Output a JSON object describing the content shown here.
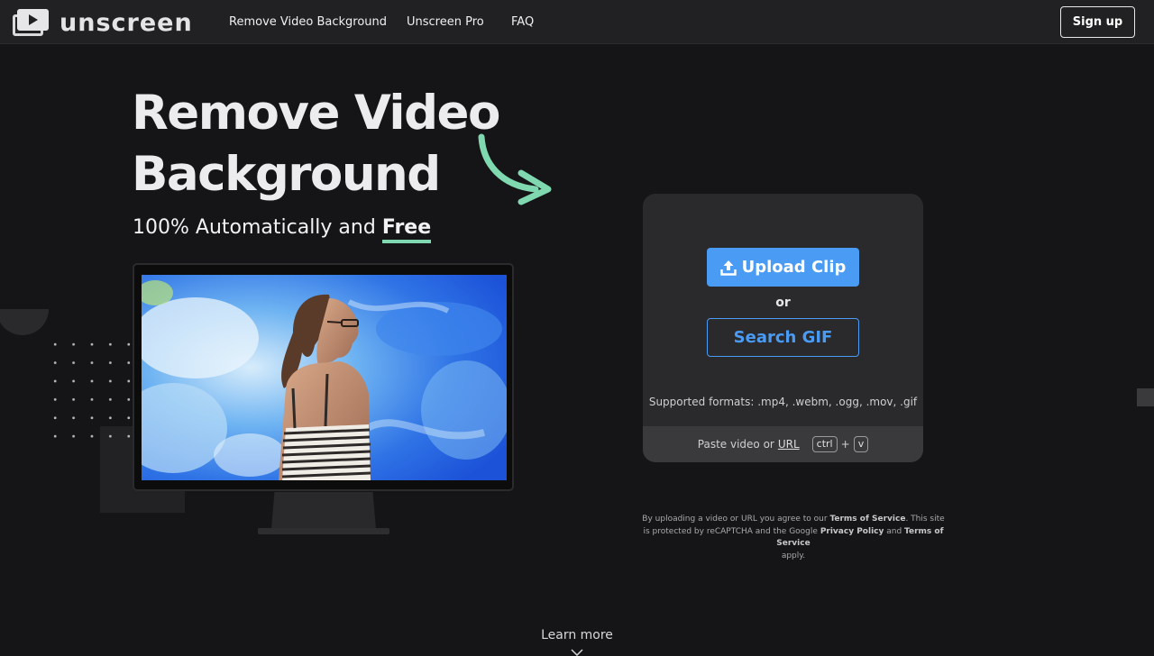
{
  "nav": {
    "brand": "unscreen",
    "links": [
      "Remove Video Background",
      "Unscreen Pro",
      "FAQ"
    ],
    "signup": "Sign up"
  },
  "hero": {
    "title_line1": "Remove Video",
    "title_line2": "Background",
    "subtitle_prefix": "100% Automatically and",
    "subtitle_emph": "Free"
  },
  "card": {
    "upload": "Upload Clip",
    "or": "or",
    "search": "Search GIF",
    "formats": "Supported formats: .mp4, .webm, .ogg, .mov, .gif",
    "paste_prefix": "Paste video or",
    "paste_url": "URL",
    "kbd_ctrl": "ctrl",
    "kbd_plus": "+",
    "kbd_v": "v"
  },
  "legal": {
    "t1": "By uploading a video or URL you agree to our",
    "tos1": "Terms of Service",
    "t2": ". This site is protected by reCAPTCHA and the Google",
    "privacy": "Privacy Policy",
    "t3": "and",
    "tos2": "Terms of Service",
    "t4": "apply."
  },
  "learn_more": "Learn more",
  "colors": {
    "background": "#151517",
    "accent_blue": "#4a9bf4",
    "accent_green": "#7fd8b0"
  }
}
